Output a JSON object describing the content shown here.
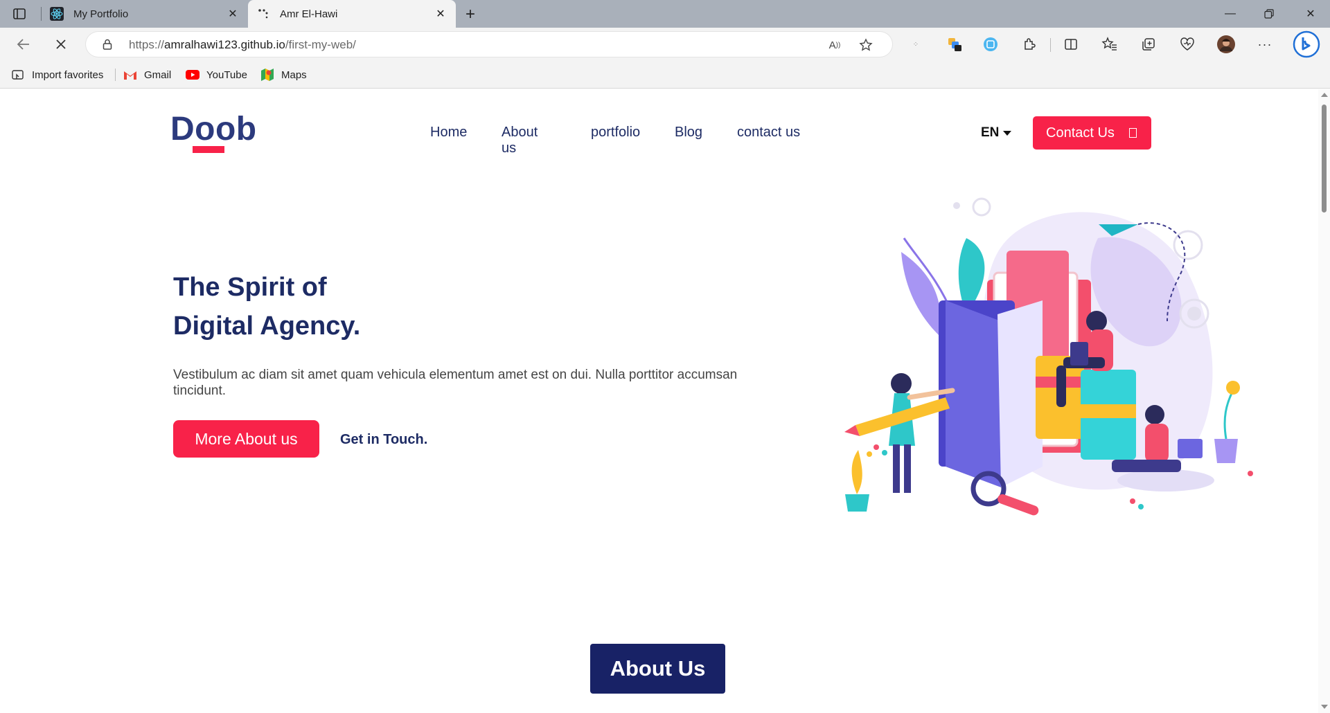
{
  "browser": {
    "tabs": [
      {
        "title": "My Portfolio",
        "active": false
      },
      {
        "title": "Amr El-Hawi",
        "active": true
      }
    ],
    "url_prefix": "https://",
    "url_host": "amralhawi123.github.io",
    "url_path": "/first-my-web/",
    "bookmarks": [
      {
        "label": "Import favorites",
        "icon": "import-icon"
      },
      {
        "label": "Gmail",
        "icon": "gmail-icon"
      },
      {
        "label": "YouTube",
        "icon": "youtube-icon"
      },
      {
        "label": "Maps",
        "icon": "maps-icon"
      }
    ],
    "colors": {
      "tabbar": "#a9b0ba",
      "toolbar": "#f3f3f3"
    }
  },
  "site": {
    "logo": "Doob",
    "nav": [
      "Home",
      "About us",
      "portfolio",
      "Blog",
      "contact us"
    ],
    "language": "EN",
    "contact_button": "Contact Us",
    "hero": {
      "title_line1": "The Spirit of",
      "title_line2": "Digital Agency.",
      "text": "Vestibulum ac diam sit amet quam vehicula elementum amet est on dui. Nulla porttitor accumsan tincidunt.",
      "primary_button": "More About us",
      "secondary_link": "Get in Touch."
    },
    "about_button": "About Us",
    "colors": {
      "accent": "#f82249",
      "navy": "#1d2b64",
      "dark_navy": "#182266"
    }
  }
}
